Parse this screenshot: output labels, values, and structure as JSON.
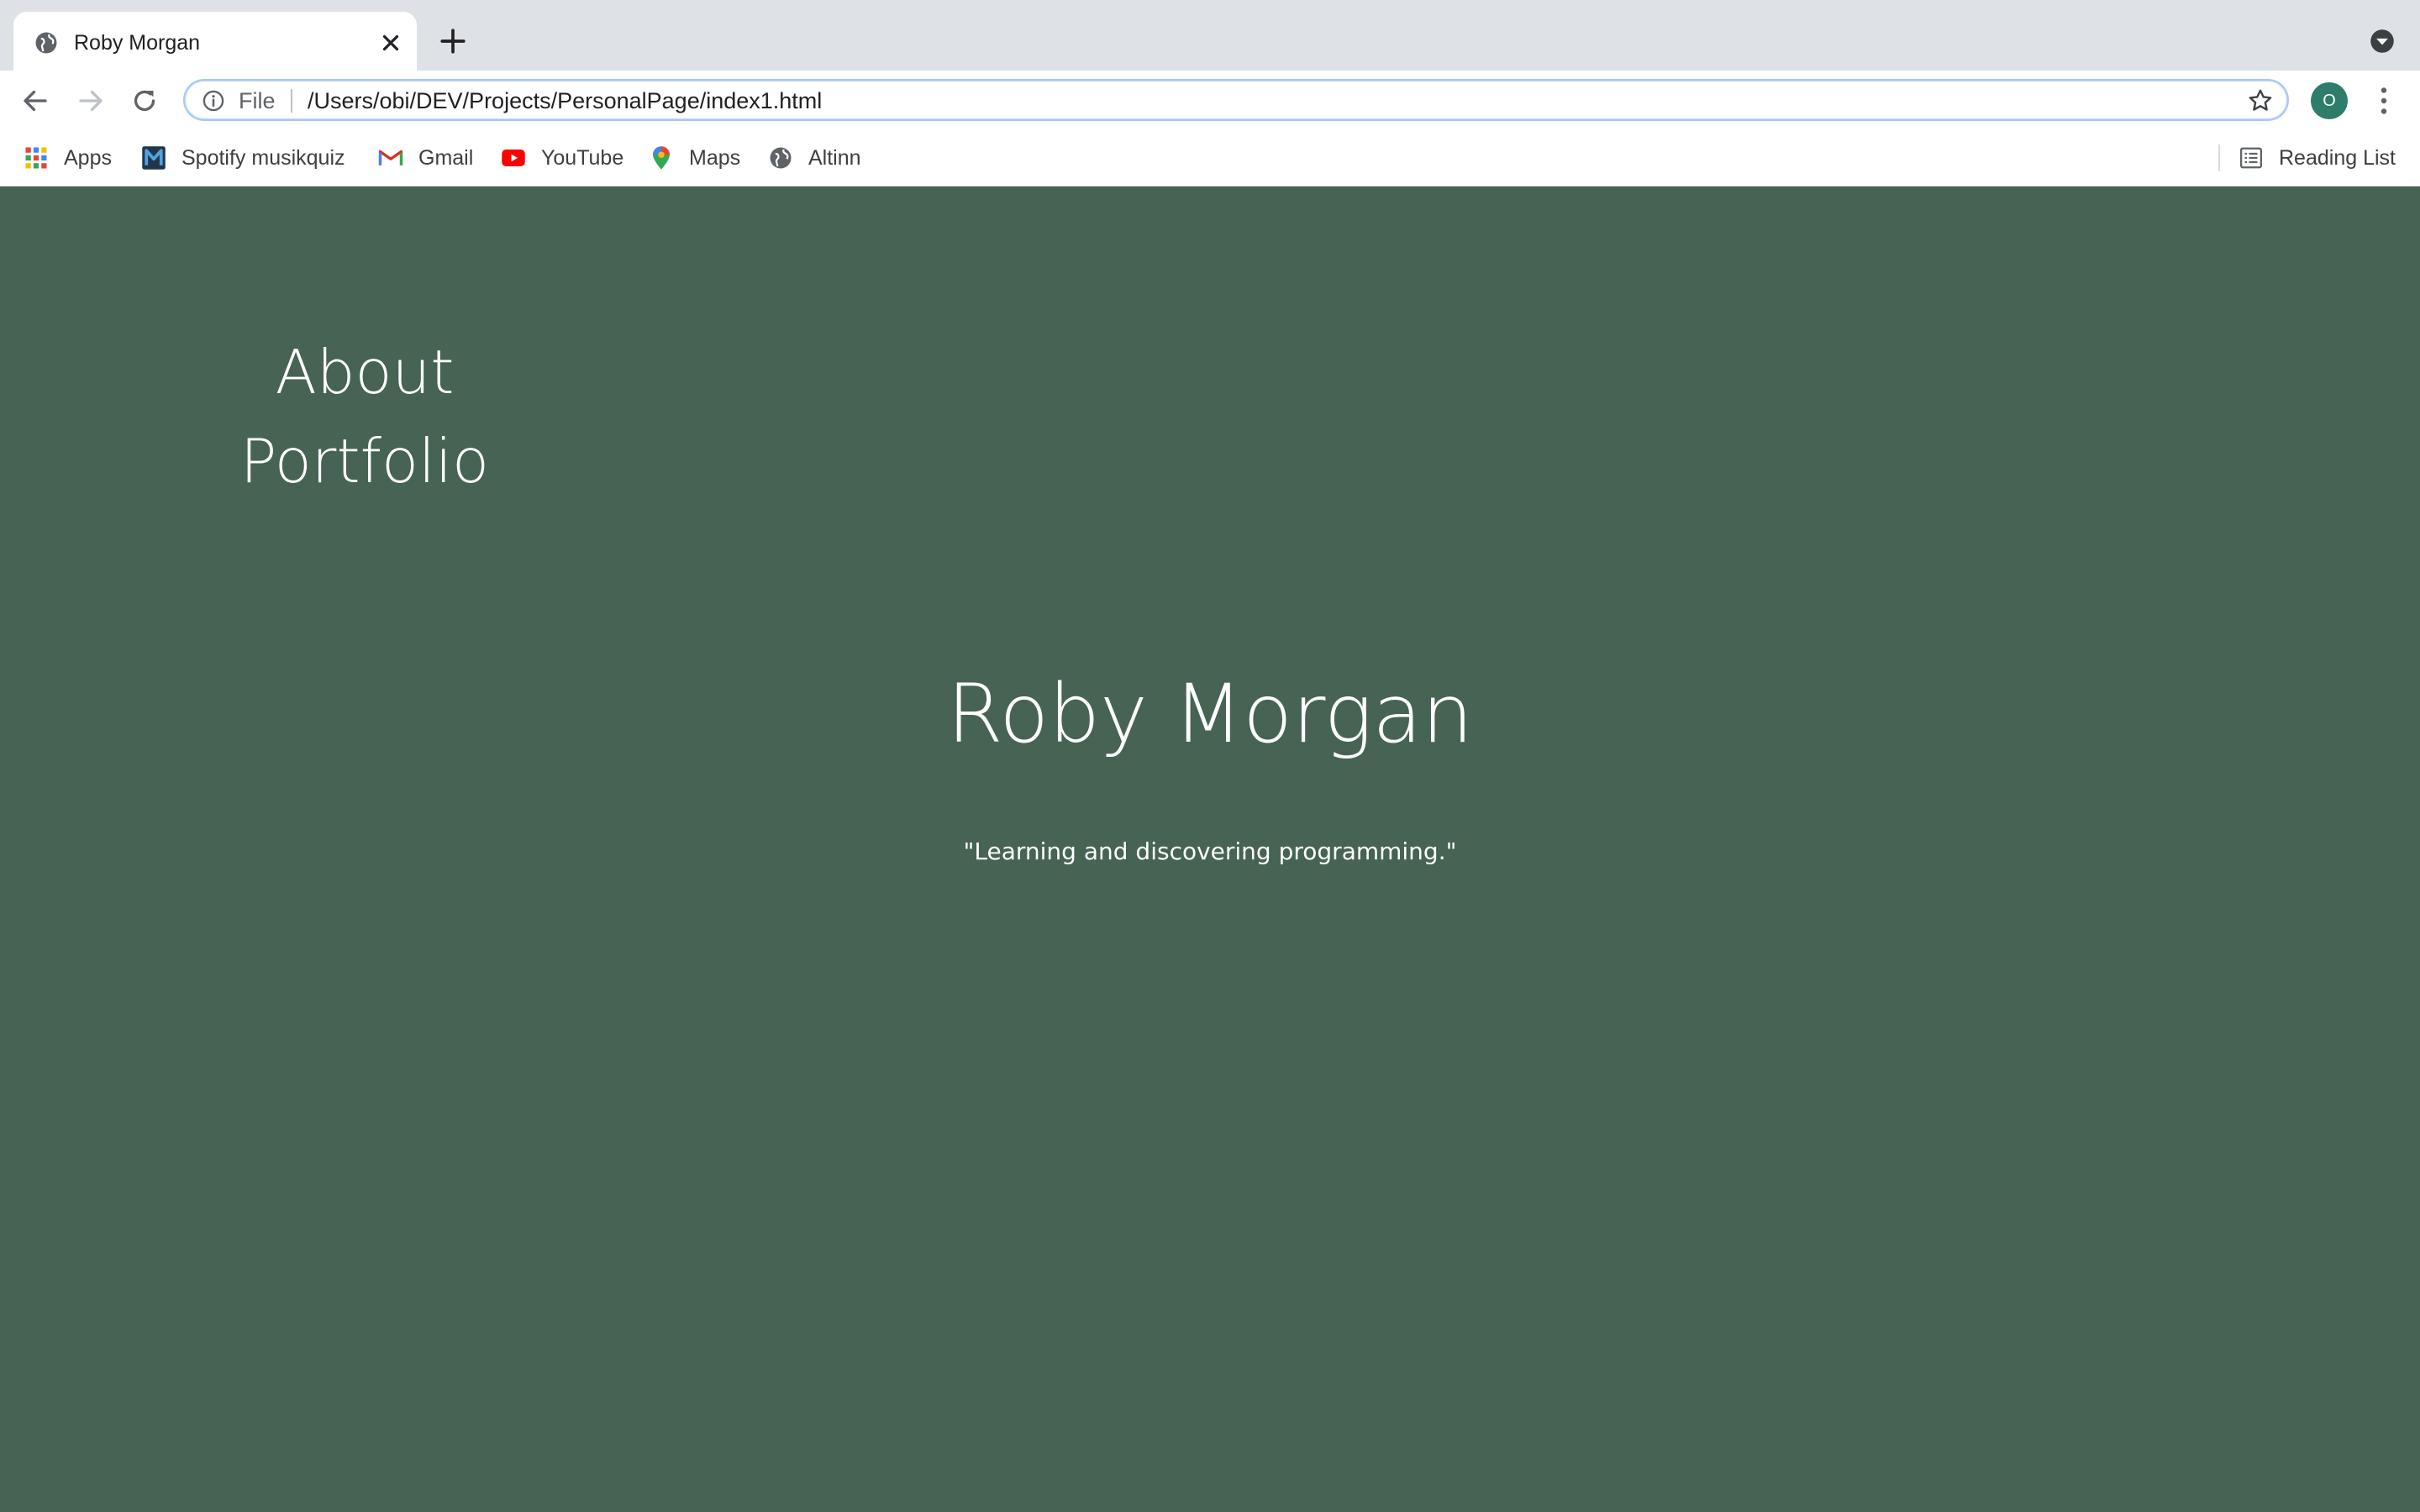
{
  "browser": {
    "tab": {
      "title": "Roby Morgan",
      "favicon_icon": "globe-icon"
    },
    "new_tab_icon": "plus-icon",
    "tab_search_icon": "chevron-down-circle-icon",
    "nav": {
      "back_icon": "arrow-left-icon",
      "forward_icon": "arrow-right-icon",
      "reload_icon": "reload-icon"
    },
    "omnibox": {
      "scheme_label": "File",
      "url": "/Users/obi/DEV/Projects/PersonalPage/index1.html",
      "info_icon": "info-icon",
      "bookmark_icon": "star-icon"
    },
    "profile": {
      "initial": "O",
      "color": "#2e7d6b"
    },
    "menu_icon": "kebab-menu-icon",
    "bookmarks": [
      {
        "label": "Apps",
        "icon": "apps-grid-icon"
      },
      {
        "label": "Spotify musikquiz",
        "icon": "m-logo-icon"
      },
      {
        "label": "Gmail",
        "icon": "gmail-icon"
      },
      {
        "label": "YouTube",
        "icon": "youtube-icon"
      },
      {
        "label": "Maps",
        "icon": "maps-pin-icon"
      },
      {
        "label": "Altinn",
        "icon": "globe-icon"
      }
    ],
    "reading_list": {
      "label": "Reading List",
      "icon": "reading-list-icon"
    }
  },
  "page": {
    "background_color": "#466354",
    "nav_links": [
      "About",
      "Portfolio"
    ],
    "hero": {
      "name": "Roby Morgan",
      "tagline": "\"Learning and discovering programming.\""
    }
  }
}
